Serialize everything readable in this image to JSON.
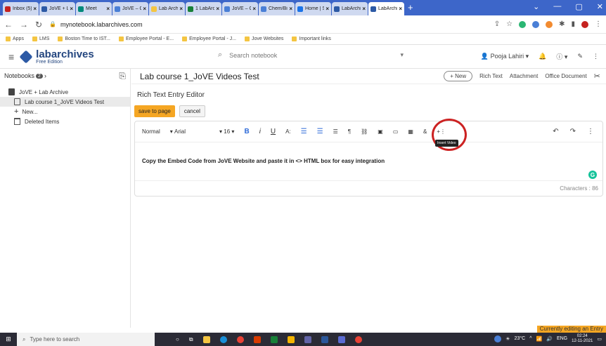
{
  "browser": {
    "tabs": [
      {
        "label": "Inbox (5)",
        "color": "#c5221f",
        "active": false
      },
      {
        "label": "JoVE + Lab",
        "color": "#2d5aa5",
        "active": false
      },
      {
        "label": "Meet",
        "color": "#00897b",
        "active": false
      },
      {
        "label": "JoVE – C",
        "color": "#4a7fd6",
        "active": false
      },
      {
        "label": "Lab Archiv",
        "color": "#f4c542",
        "active": false
      },
      {
        "label": "1 LabArch",
        "color": "#188038",
        "active": false
      },
      {
        "label": "JoVE – C",
        "color": "#4a7fd6",
        "active": false
      },
      {
        "label": "Chem/Bio",
        "color": "#4a7fd6",
        "active": false
      },
      {
        "label": "Home | S",
        "color": "#1a73e8",
        "active": false
      },
      {
        "label": "LabArchiv",
        "color": "#2d5aa5",
        "active": false
      },
      {
        "label": "LabArchiv",
        "color": "#2d5aa5",
        "active": true
      }
    ],
    "url": "mynotebook.labarchives.com",
    "bookmarks": [
      "Apps",
      "LMS",
      "Boston Time to IST...",
      "Employee Portal - E...",
      "Employee Portal - J...",
      "Jove Websites",
      "Important links"
    ]
  },
  "header": {
    "brand": "labarchives",
    "edition": "Free Edition",
    "search_placeholder": "Search notebook",
    "user": "Pooja Lahiri"
  },
  "sidebar": {
    "notebooks_label": "Notebooks",
    "notebooks_count": "2",
    "items": [
      {
        "label": "JoVE + Lab Archive"
      },
      {
        "label": "Lab course 1_JoVE Videos Test"
      },
      {
        "label": "New..."
      },
      {
        "label": "Deleted Items"
      }
    ]
  },
  "main": {
    "page_title": "Lab course 1_JoVE Videos Test",
    "actions": {
      "new": "New",
      "rich_text": "Rich Text",
      "attachment": "Attachment",
      "office_document": "Office Document"
    },
    "entry_label": "Rich Text Entry Editor",
    "save_label": "save to page",
    "cancel_label": "cancel",
    "toolbar": {
      "style": "Normal",
      "font": "Arial",
      "size": "16",
      "bold": "B",
      "italic": "i",
      "underline": "U",
      "font_size_icon": "A:",
      "tooltip": "Insert Video"
    },
    "content_text": "Copy the Embed Code from JoVE Website and paste it in <> HTML box for easy integration",
    "characters": "Characters : 86",
    "status": "Currently editing an Entry"
  },
  "taskbar": {
    "search_placeholder": "Type here to search",
    "temperature": "23°C",
    "language": "ENG",
    "time": "02:24",
    "date": "12-11-2021"
  }
}
